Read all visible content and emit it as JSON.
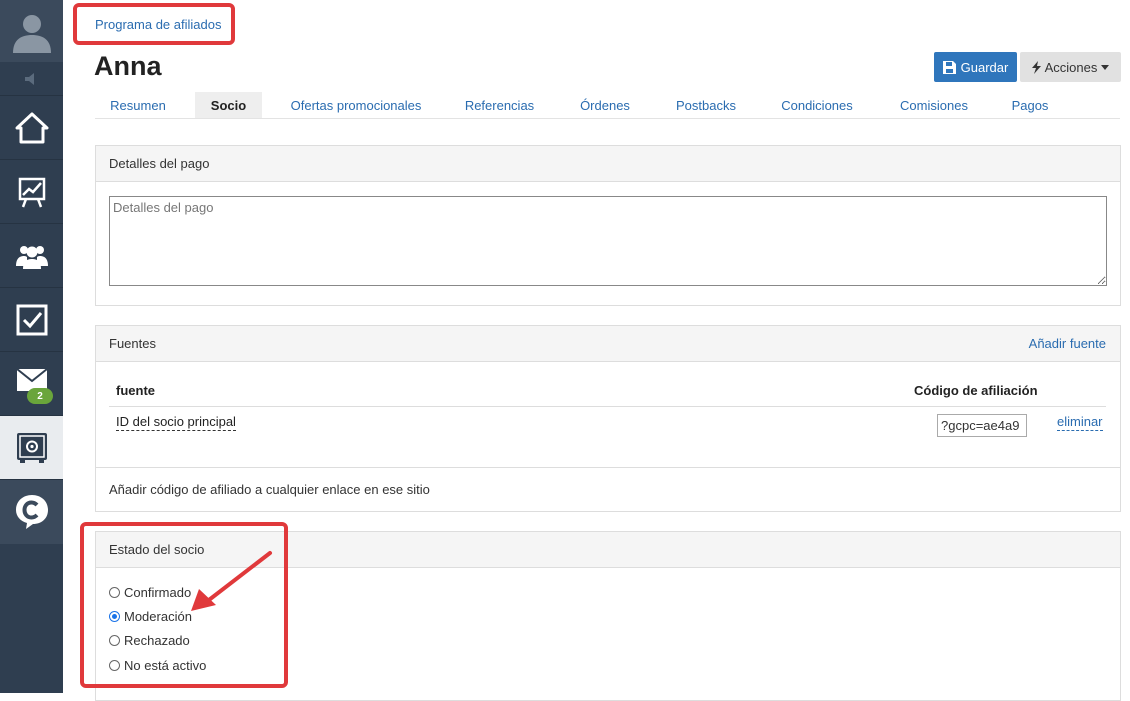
{
  "sidebar": {
    "items": [
      {
        "icon": "home-icon"
      },
      {
        "icon": "chart-icon"
      },
      {
        "icon": "users-icon"
      },
      {
        "icon": "checkbox-icon"
      },
      {
        "icon": "mail-icon",
        "badge": "2"
      },
      {
        "icon": "safe-icon"
      }
    ],
    "brand_icon": "brand-c-icon"
  },
  "breadcrumb": "Programa de afiliados",
  "page_title": "Anna",
  "toolbar": {
    "save_label": "Guardar",
    "actions_label": "Acciones"
  },
  "tabs": [
    "Resumen",
    "Socio",
    "Ofertas promocionales",
    "Referencias",
    "Órdenes",
    "Postbacks",
    "Condiciones",
    "Comisiones",
    "Pagos"
  ],
  "active_tab": "Socio",
  "payment_panel": {
    "title": "Detalles del pago",
    "placeholder": "Detalles del pago"
  },
  "sources_panel": {
    "title": "Fuentes",
    "add_link": "Añadir fuente",
    "columns": [
      "fuente",
      "Código de afiliación"
    ],
    "rows": [
      {
        "source": "ID del socio principal",
        "code": "?gcpc=ae4a9",
        "action": "eliminar"
      }
    ],
    "footer": "Añadir código de afiliado a cualquier enlace en ese sitio"
  },
  "status_panel": {
    "title": "Estado del socio",
    "options": [
      "Confirmado",
      "Moderación",
      "Rechazado",
      "No está activo"
    ],
    "selected": "Moderación"
  },
  "colors": {
    "primary": "#2f76bc",
    "sidebar": "#2f3e50",
    "highlight": "#e0393b",
    "badge": "#6aa53b"
  }
}
